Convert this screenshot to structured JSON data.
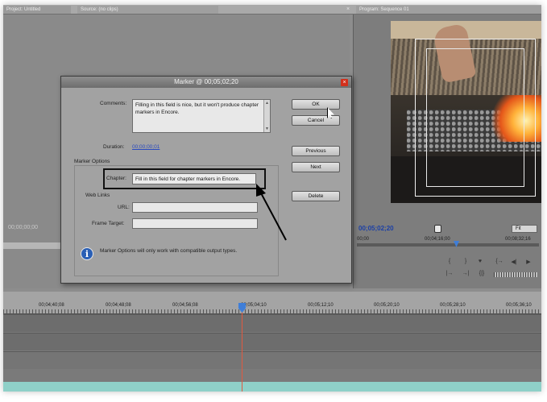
{
  "tabs": {
    "left": "Project: Untitled",
    "middle": "Source: (no clips)",
    "right": "Program: Sequence 01"
  },
  "source_monitor": {
    "timecode": "00;00;00;00"
  },
  "program_monitor": {
    "timecode": "00;05;02;20",
    "fit_label": "Fit",
    "ruler": {
      "start": "00;00",
      "mid": "00;04;16;00",
      "end": "00;08;32;16"
    },
    "controls": [
      "{",
      "}",
      "♥",
      "{→",
      "◀|",
      "▶",
      "|→",
      "→|",
      "{|}"
    ]
  },
  "dialog": {
    "title": "Marker @ 00;05;02;20",
    "close_label": "×",
    "comments_label": "Comments:",
    "comments_value": "Filling in this field is nice, but it won't produce chapter markers in Encore.",
    "duration_label": "Duration:",
    "duration_value": "00;00;00;01",
    "marker_options_label": "Marker Options",
    "chapter_label": "Chapter:",
    "chapter_value": "Fill in this field for chapter markers in Encore.",
    "web_links_label": "Web Links",
    "url_label": "URL:",
    "url_value": "",
    "frame_target_label": "Frame Target:",
    "frame_target_value": "",
    "info_text": "Marker Options will only work with compatible output types.",
    "buttons": {
      "ok": "OK",
      "cancel": "Cancel",
      "previous": "Previous",
      "next": "Next",
      "delete": "Delete"
    }
  },
  "timeline": {
    "ticks": [
      "00;04;40;08",
      "00;04;48;08",
      "00;04;56;08",
      "00;05;04;10",
      "00;05;12;10",
      "00;05;20;10",
      "00;05;28;10",
      "00;05;36;10"
    ]
  },
  "colors": {
    "timecode_blue": "#1b3fa6",
    "playhead": "#3f7ed8",
    "playhead_line": "#e05a40",
    "close_red": "#d2301c",
    "track_teal": "#8fd0c8"
  }
}
